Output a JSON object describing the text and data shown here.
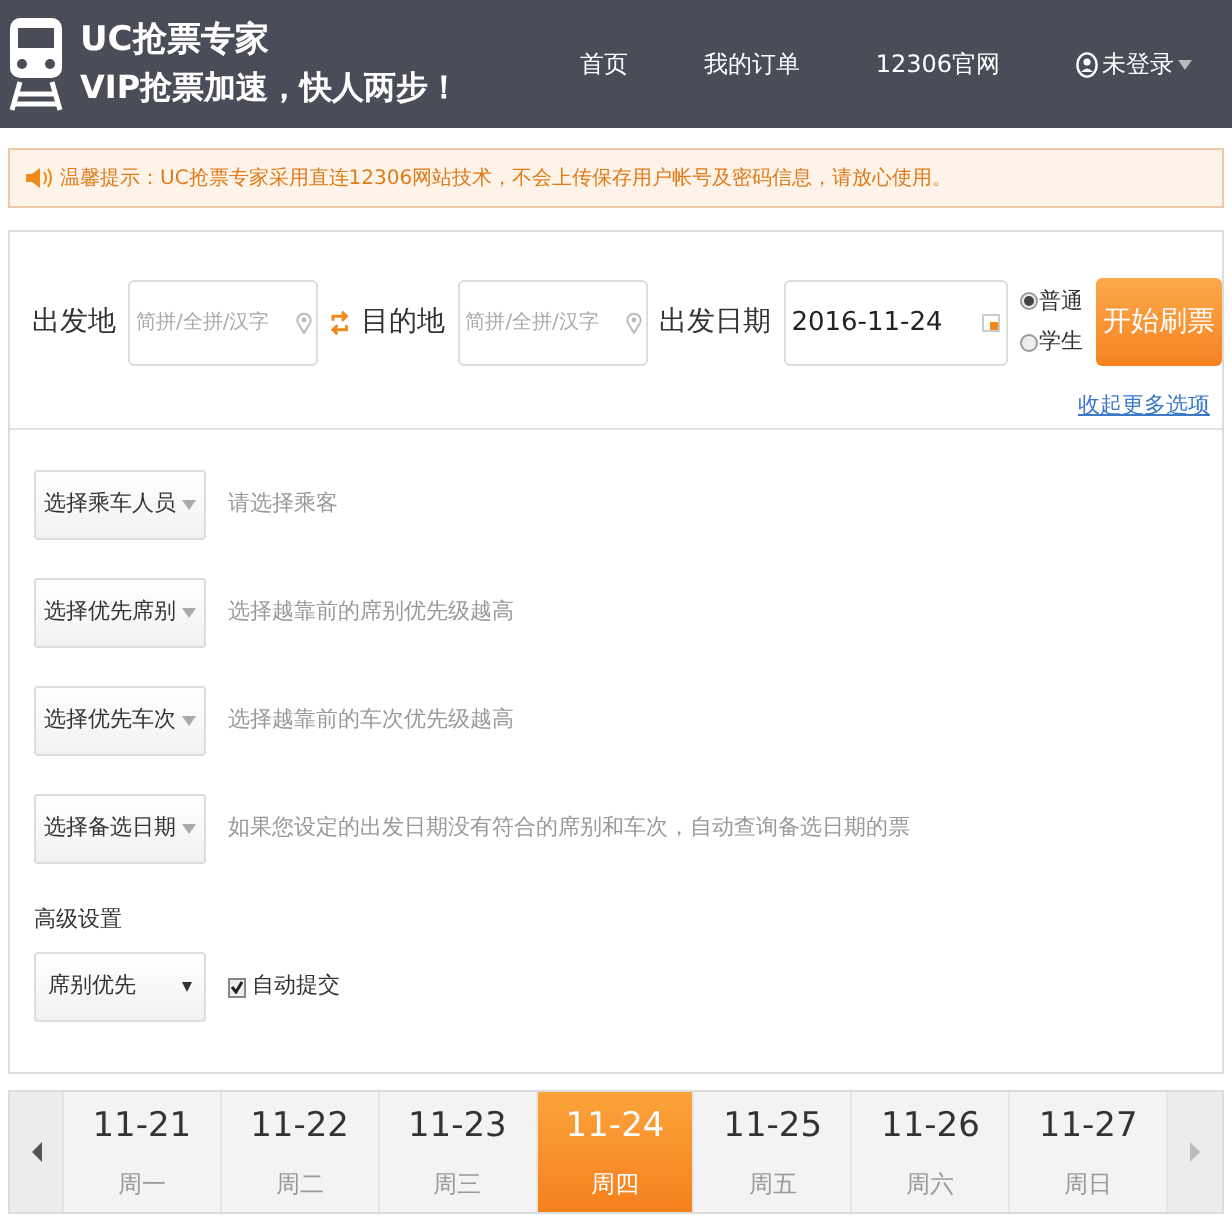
{
  "header": {
    "brand": "UC抢票专家",
    "slogan": "VIP抢票加速，快人两步！",
    "nav": [
      {
        "label": "首页"
      },
      {
        "label": "我的订单"
      },
      {
        "label": "12306官网"
      }
    ],
    "user": "未登录"
  },
  "notice": "温馨提示：UC抢票专家采用直连12306网站技术，不会上传保存用户帐号及密码信息，请放心使用。",
  "search": {
    "from_label": "出发地",
    "from_placeholder": "简拼/全拼/汉字",
    "to_label": "目的地",
    "to_placeholder": "简拼/全拼/汉字",
    "date_label": "出发日期",
    "date": "2016-11-24",
    "ticket_types": [
      {
        "label": "普通",
        "selected": true
      },
      {
        "label": "学生",
        "selected": false
      }
    ],
    "submit": "开始刷票",
    "more_link": "收起更多选项"
  },
  "options": [
    {
      "select": "选择乘车人员",
      "hint": "请选择乘客"
    },
    {
      "select": "选择优先席别",
      "hint": "选择越靠前的席别优先级越高"
    },
    {
      "select": "选择优先车次",
      "hint": "选择越靠前的车次优先级越高"
    },
    {
      "select": "选择备选日期",
      "hint": "如果您设定的出发日期没有符合的席别和车次，自动查询备选日期的票"
    }
  ],
  "advanced": {
    "title": "高级设置",
    "mode": "席别优先",
    "auto_submit": {
      "label": "自动提交",
      "checked": true
    }
  },
  "dates": [
    {
      "date": "11-21",
      "weekday": "周一",
      "selected": false
    },
    {
      "date": "11-22",
      "weekday": "周二",
      "selected": false
    },
    {
      "date": "11-23",
      "weekday": "周三",
      "selected": false
    },
    {
      "date": "11-24",
      "weekday": "周四",
      "selected": true
    },
    {
      "date": "11-25",
      "weekday": "周五",
      "selected": false
    },
    {
      "date": "11-26",
      "weekday": "周六",
      "selected": false
    },
    {
      "date": "11-27",
      "weekday": "周日",
      "selected": false
    }
  ]
}
